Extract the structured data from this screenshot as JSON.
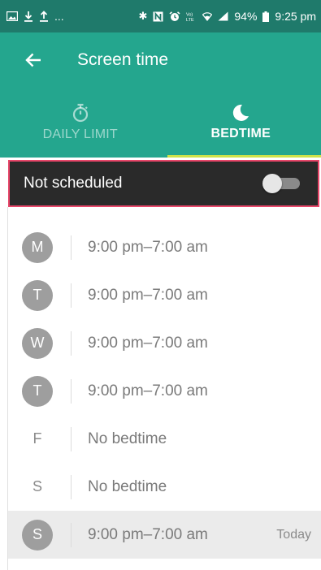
{
  "status_bar": {
    "left_icons": [
      "image-icon",
      "download-icon",
      "upload-icon"
    ],
    "overflow": "...",
    "right_icons": [
      "bluetooth-icon",
      "nfc-icon",
      "alarm-icon",
      "volte-icon",
      "wifi-icon",
      "signal-icon"
    ],
    "battery": "94%",
    "time": "9:25 pm"
  },
  "app_bar": {
    "title": "Screen time"
  },
  "tabs": [
    {
      "label": "DAILY LIMIT",
      "icon": "stopwatch-icon",
      "active": false
    },
    {
      "label": "BEDTIME",
      "icon": "moon-icon",
      "active": true
    }
  ],
  "schedule": {
    "label": "Not scheduled",
    "enabled": false
  },
  "days": [
    {
      "letter": "M",
      "time": "9:00 pm–7:00 am",
      "has_bedtime": true,
      "today": false,
      "today_label": ""
    },
    {
      "letter": "T",
      "time": "9:00 pm–7:00 am",
      "has_bedtime": true,
      "today": false,
      "today_label": ""
    },
    {
      "letter": "W",
      "time": "9:00 pm–7:00 am",
      "has_bedtime": true,
      "today": false,
      "today_label": ""
    },
    {
      "letter": "T",
      "time": "9:00 pm–7:00 am",
      "has_bedtime": true,
      "today": false,
      "today_label": ""
    },
    {
      "letter": "F",
      "time": "No bedtime",
      "has_bedtime": false,
      "today": false,
      "today_label": ""
    },
    {
      "letter": "S",
      "time": "No bedtime",
      "has_bedtime": false,
      "today": false,
      "today_label": ""
    },
    {
      "letter": "S",
      "time": "9:00 pm–7:00 am",
      "has_bedtime": true,
      "today": true,
      "today_label": "Today"
    }
  ],
  "colors": {
    "status_bar": "#1f7a6b",
    "app_bar": "#24a68e",
    "tab_indicator": "#cde24a",
    "schedule_bg": "#2a2a2a",
    "highlight_border": "#e8476a",
    "day_circle": "#9e9e9e"
  }
}
